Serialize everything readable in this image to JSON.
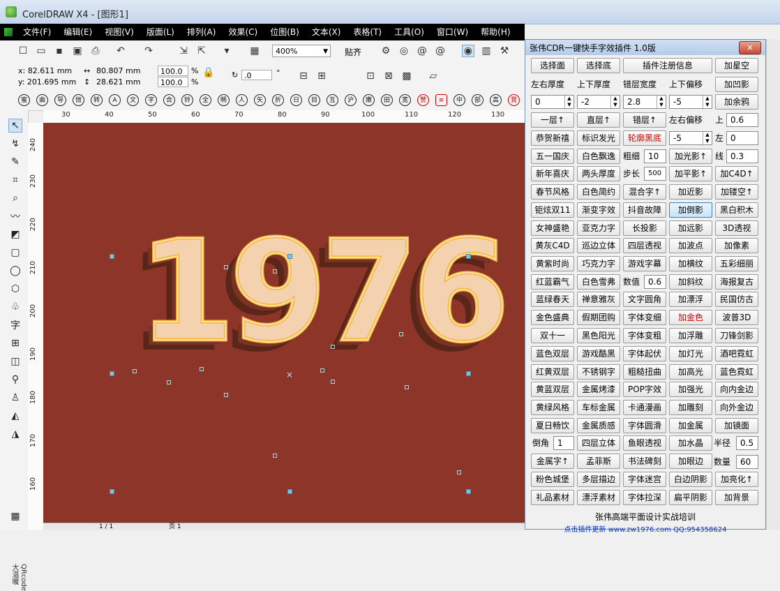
{
  "window": {
    "title": "CorelDRAW X4 - [图形1]"
  },
  "menu": [
    "文件(F)",
    "编辑(E)",
    "视图(V)",
    "版面(L)",
    "排列(A)",
    "效果(C)",
    "位图(B)",
    "文本(X)",
    "表格(T)",
    "工具(O)",
    "窗口(W)",
    "帮助(H)"
  ],
  "toolbar": {
    "zoom": "400%",
    "snap": "贴齐"
  },
  "props": {
    "x": "x: 82.611 mm",
    "y": "y: 201.695 mm",
    "w": "80.807 mm",
    "h": "28.621 mm",
    "sx": "100.0",
    "sy": "100.0",
    "pct1": "%",
    "pct2": "%",
    "rot": ".0",
    "deg": "°"
  },
  "glyphs": [
    "蜜",
    "曲",
    "导",
    "倣",
    "转",
    "A",
    "文",
    "字",
    "合",
    "铃",
    "全",
    "畅",
    "人",
    "矢",
    "折",
    "日",
    "目",
    "互",
    "沪",
    "嫩",
    "田",
    "宽",
    "赞"
  ],
  "ruler_h": [
    "30",
    "40",
    "50",
    "60",
    "70",
    "80",
    "90",
    "100",
    "110",
    "120",
    "130"
  ],
  "ruler_v": [
    "240",
    "230",
    "220",
    "210",
    "200",
    "190",
    "180",
    "170",
    "160"
  ],
  "sidebar_tab": "QRcode大温暖",
  "status": {
    "pages": "1 / 1",
    "page": "页 1"
  },
  "canvas": {
    "text": "1976",
    "bg": "#8c3528",
    "fill": "#f4d2b0",
    "outline": "#f6b534",
    "shadow": "#5a2619"
  },
  "plugin": {
    "title": "张伟CDR一键快手字效插件  1.0版",
    "close": "×",
    "row1": [
      "选择面",
      "选择底",
      "插件注册信息",
      "加星空"
    ],
    "row2_labels": [
      "左右厚度",
      "上下厚度",
      "错层宽度",
      "上下偏移",
      "加凹影"
    ],
    "row3_values": [
      "0",
      "-2",
      "2.8",
      "-5"
    ],
    "row3_btn": "加余鸦",
    "row4": [
      "一层↑",
      "直层↑",
      "错层↑"
    ],
    "row4_label": "左右偏移",
    "up_label": "上",
    "up_value": "0.6",
    "row5": [
      "恭贺新禧",
      "标识发光",
      "轮廓黑底"
    ],
    "row5_value": "-5",
    "left_label": "左",
    "left_value": "0",
    "row6": [
      "五一国庆",
      "白色飘逸"
    ],
    "cu_label": "粗细",
    "cu_value": "10",
    "row6_btn": "加光影↑",
    "line_label": "线",
    "line_value": "0.3",
    "row7": [
      "新年喜庆",
      "两头厚度"
    ],
    "step_label": "步长",
    "step_value": "500",
    "row7_btns": [
      "加平影↑",
      "加C4D↑"
    ],
    "row8": [
      "春节风格",
      "白色简约",
      "混合字↑",
      "加近影",
      "加镂空↑"
    ],
    "row9": [
      "钜炫双11",
      "渐变字效",
      "抖音故障",
      "加倒影",
      "黑白积木"
    ],
    "row10": [
      "女神盛艳",
      "亚克力字",
      "长投影",
      "加远影",
      "3D透视"
    ],
    "row11": [
      "黄灰C4D",
      "巡边立体",
      "四层透视",
      "加波点",
      "加像素"
    ],
    "row12": [
      "黄紫时尚",
      "巧克力字",
      "游戏字幕",
      "加横纹",
      "五彩细丽"
    ],
    "row13": [
      "红蓝霸气",
      "白色雪弗"
    ],
    "num_label": "数值",
    "num_value": "0.6",
    "row13_btns": [
      "加斜纹",
      "海报复古"
    ],
    "row14": [
      "蓝绿春天",
      "禅意雅灰",
      "文字圆角",
      "加漂浮",
      "民国仿古"
    ],
    "row15": [
      "金色盛典",
      "假期团购",
      "字体变细",
      "加金色",
      "波普3D"
    ],
    "row16": [
      "双十一",
      "黑色阳光",
      "字体变粗",
      "加浮雕",
      "刀锋剑影"
    ],
    "row17": [
      "蓝色双层",
      "游戏酷黑",
      "字体起伏",
      "加灯光",
      "酒吧霓虹"
    ],
    "row18": [
      "红黄双层",
      "不锈钢字",
      "粗糙扭曲",
      "加高光",
      "蓝色霓虹"
    ],
    "row19": [
      "黄蓝双层",
      "金属烤漆",
      "POP字效",
      "加强光",
      "向内金边"
    ],
    "row20": [
      "黄绿风格",
      "车标金属",
      "卡通漫画",
      "加雕刻",
      "向外金边"
    ],
    "row21": [
      "夏日畅饮",
      "金属质感",
      "字体圆滑",
      "加金属",
      "加镜面"
    ],
    "dj_label": "倒角",
    "dj_value": "1",
    "row22": [
      "四层立体",
      "鱼眼透视",
      "加水晶"
    ],
    "rad_label": "半径",
    "rad_value": "0.5",
    "row23": [
      "金属字↑",
      "孟菲斯",
      "书法碑刻",
      "加眼边"
    ],
    "qty_label": "数量",
    "qty_value": "60",
    "row24": [
      "粉色城堡",
      "多层描边",
      "字体迷宫",
      "白边阴影",
      "加亮化↑"
    ],
    "row25": [
      "礼品素材",
      "漂浮素材",
      "字体拉深",
      "扁平阴影",
      "加背景"
    ],
    "footer": "张伟高端平面设计实战培训",
    "footer_link": "点击插件更新  www.zw1976.com    QQ:954358624"
  }
}
